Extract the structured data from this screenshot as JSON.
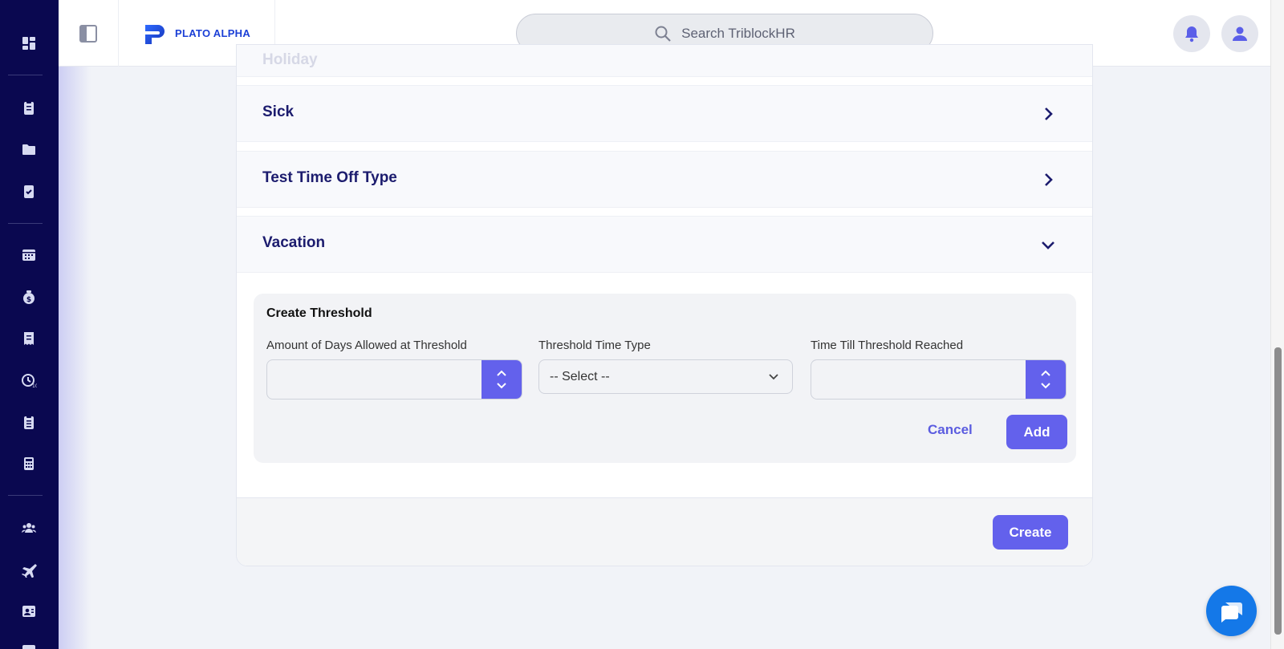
{
  "app": {
    "brand": "PLATO ALPHA",
    "brand_color": "#1b3fd6",
    "accent": "#6361ec",
    "sidebar_bg": "#0a0850"
  },
  "header": {
    "search_placeholder": "Search TriblockHR"
  },
  "sidebar": {
    "icons": [
      "dashboard-icon",
      "clipboard-icon",
      "folder-icon",
      "checklist-icon",
      "calendar-icon",
      "money-bag-icon",
      "receipt-icon",
      "timer-icon",
      "clipboard-list-icon",
      "calculator-icon",
      "users-icon",
      "plane-icon",
      "contact-card-icon",
      "calendar-partial-icon"
    ]
  },
  "accordion": {
    "faded_label": "Holiday",
    "rows": [
      {
        "label": "Sick",
        "state": "collapsed"
      },
      {
        "label": "Test Time Off Type",
        "state": "collapsed"
      },
      {
        "label": "Vacation",
        "state": "expanded"
      }
    ]
  },
  "threshold": {
    "title": "Create Threshold",
    "amount_label": "Amount of Days Allowed at Threshold",
    "amount_value": "",
    "type_label": "Threshold Time Type",
    "type_selected": "-- Select --",
    "till_label": "Time Till Threshold Reached",
    "till_value": "",
    "cancel_label": "Cancel",
    "add_label": "Add"
  },
  "footer": {
    "create_label": "Create"
  }
}
